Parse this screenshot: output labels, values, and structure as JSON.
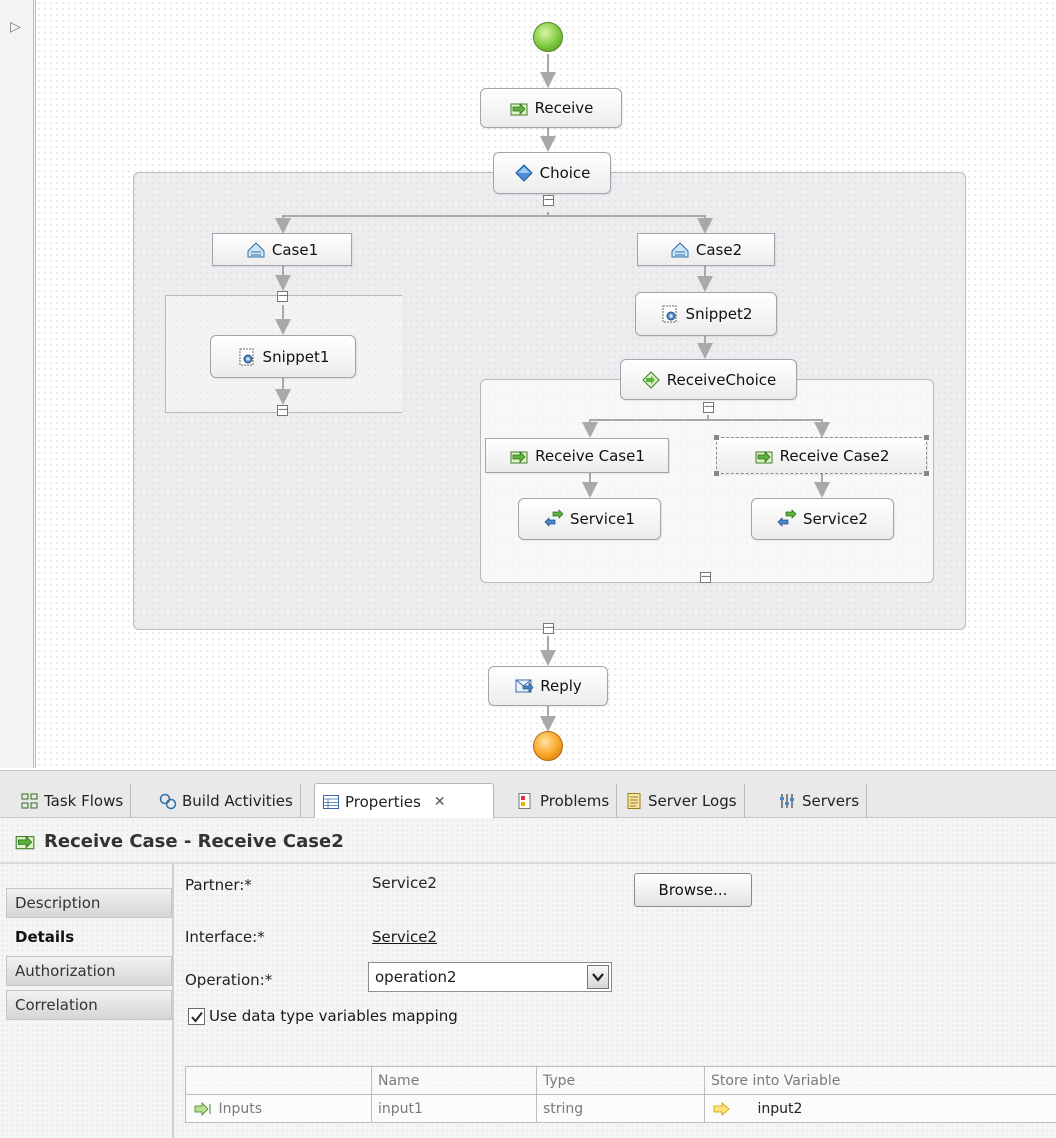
{
  "diagram": {
    "nodes": {
      "receive": "Receive",
      "choice": "Choice",
      "case1": "Case1",
      "case2": "Case2",
      "snippet1": "Snippet1",
      "snippet2": "Snippet2",
      "receive_choice": "ReceiveChoice",
      "receive_case1": "Receive Case1",
      "receive_case2": "Receive Case2",
      "service1": "Service1",
      "service2": "Service2",
      "reply": "Reply"
    }
  },
  "views": {
    "tabs": [
      {
        "label": "Task Flows",
        "icon": "task-flows-icon"
      },
      {
        "label": "Build Activities",
        "icon": "build-activities-icon"
      },
      {
        "label": "Properties",
        "icon": "properties-icon"
      },
      {
        "label": "Problems",
        "icon": "problems-icon"
      },
      {
        "label": "Server Logs",
        "icon": "server-logs-icon"
      },
      {
        "label": "Servers",
        "icon": "servers-icon"
      }
    ],
    "active_tab": "Properties"
  },
  "properties": {
    "title": "Receive Case - Receive Case2",
    "side_tabs": [
      "Description",
      "Details",
      "Authorization",
      "Correlation"
    ],
    "active_side_tab": "Details",
    "partner_label": "Partner:*",
    "partner_value": "Service2",
    "browse_label": "Browse...",
    "interface_label": "Interface:*",
    "interface_value": "Service2",
    "operation_label": "Operation:*",
    "operation_value": "operation2",
    "mapping_label": "Use data type variables mapping",
    "mapping_checked": true,
    "table": {
      "headers": [
        "",
        "Name",
        "Type",
        "Store into Variable"
      ],
      "rows": [
        {
          "kind": "Inputs",
          "name": "input1",
          "type": "string",
          "variable": "input2"
        }
      ]
    }
  },
  "colors": {
    "start": "#7ec83e",
    "end": "#f7a323",
    "node_border": "#9fa5ad",
    "container_fill": "#dedee2"
  }
}
